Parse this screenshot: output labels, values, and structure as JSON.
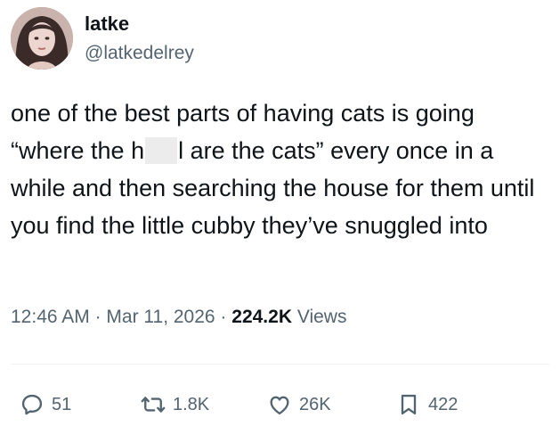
{
  "author": {
    "name": "latke",
    "handle": "@latkedelrey"
  },
  "tweet": {
    "text_before_redaction": "one of the best parts of having cats is going “where the h",
    "text_after_redaction": "l are the cats” every once in a while and then searching the house for them until you find the little cubby they’ve snuggled into"
  },
  "meta": {
    "time": "12:46 AM",
    "separator1": " · ",
    "date": "Mar 11, 2026",
    "separator2": " · ",
    "views_count": "224.2K",
    "views_label": " Views"
  },
  "actions": {
    "replies": "51",
    "reposts": "1.8K",
    "likes": "26K",
    "bookmarks": "422"
  },
  "icons": {
    "reply": "speech-bubble-icon",
    "repost": "repost-arrows-icon",
    "like": "heart-icon",
    "bookmark": "bookmark-icon"
  },
  "colors": {
    "text_primary": "#0f1419",
    "text_secondary": "#536471",
    "divider": "#eff3f4",
    "redaction": "#ececec"
  }
}
